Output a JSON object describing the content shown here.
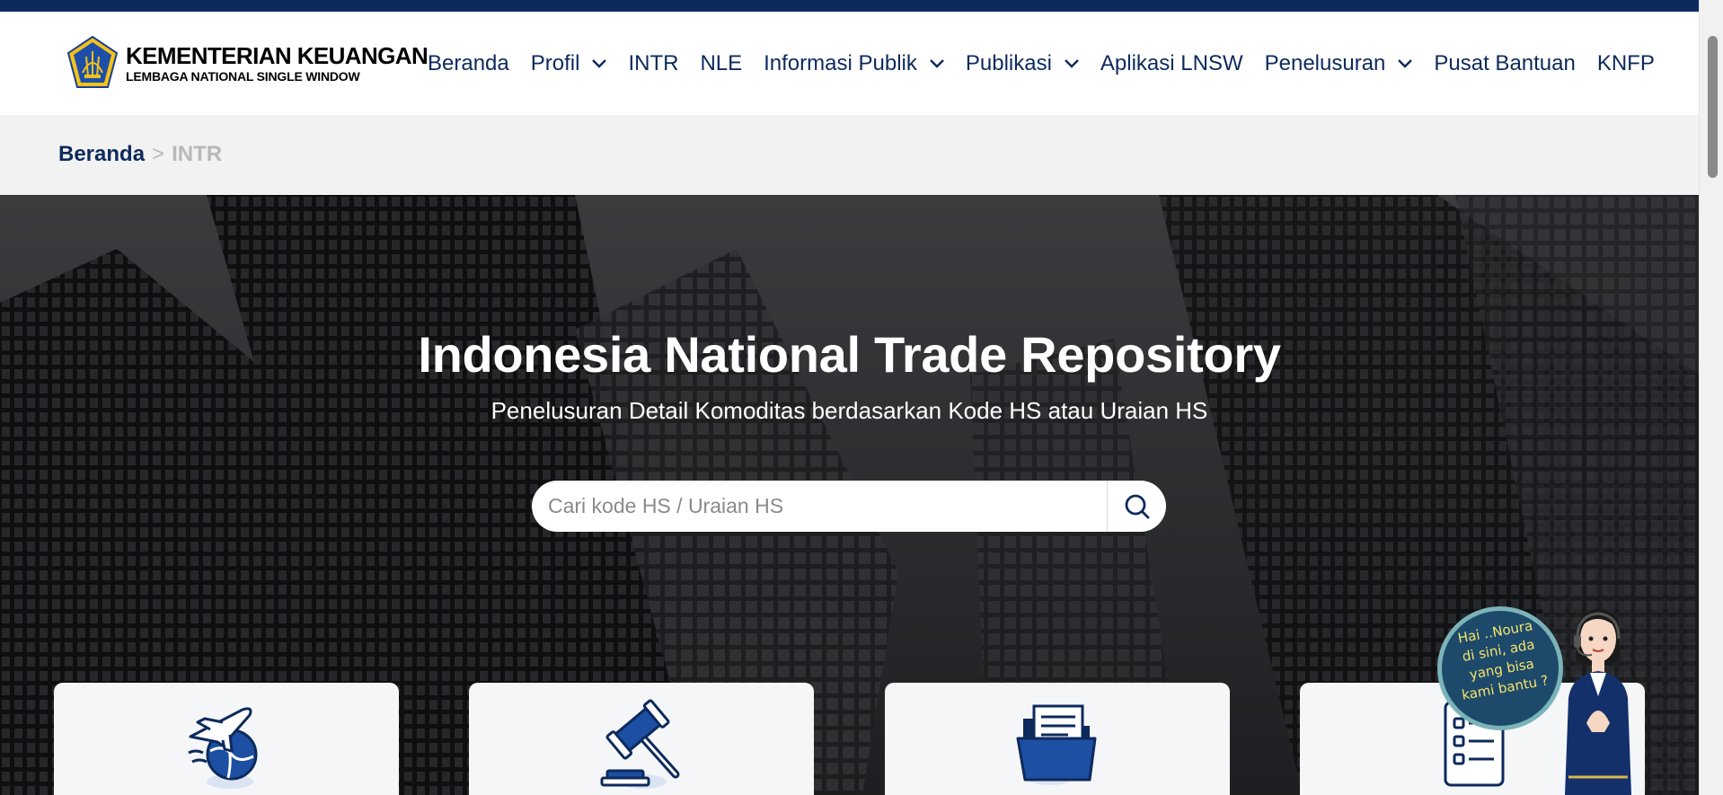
{
  "brand": {
    "title": "KEMENTERIAN KEUANGAN",
    "subtitle": "LEMBAGA NATIONAL SINGLE WINDOW",
    "logo_icon": "garuda-emblem-icon"
  },
  "nav": {
    "items": [
      {
        "label": "Beranda",
        "dropdown": false
      },
      {
        "label": "Profil",
        "dropdown": true
      },
      {
        "label": "INTR",
        "dropdown": false
      },
      {
        "label": "NLE",
        "dropdown": false
      },
      {
        "label": "Informasi Publik",
        "dropdown": true
      },
      {
        "label": "Publikasi",
        "dropdown": true
      },
      {
        "label": "Aplikasi LNSW",
        "dropdown": false
      },
      {
        "label": "Penelusuran",
        "dropdown": true
      },
      {
        "label": "Pusat Bantuan",
        "dropdown": false
      },
      {
        "label": "KNFP",
        "dropdown": false
      }
    ]
  },
  "breadcrumb": {
    "home": "Beranda",
    "separator": ">",
    "current": "INTR"
  },
  "hero": {
    "title": "Indonesia National Trade Repository",
    "subtitle": "Penelusuran Detail Komoditas berdasarkan Kode HS atau Uraian HS"
  },
  "search": {
    "placeholder": "Cari kode HS / Uraian HS",
    "value": "",
    "icon": "search-icon"
  },
  "cards": [
    {
      "icon": "airplane-globe-icon"
    },
    {
      "icon": "gavel-icon"
    },
    {
      "icon": "folder-documents-icon"
    },
    {
      "icon": "checklist-icon"
    }
  ],
  "chat": {
    "bubble_text": "Hai ..Noura\ndi sini, ada\nyang bisa\nkami bantu ?",
    "avatar_icon": "customer-service-agent-icon"
  },
  "colors": {
    "primary": "#0d2a5c",
    "crumb_bg": "#f2f2f2",
    "muted": "#b8b8b8",
    "card_bg": "#f5f6f8",
    "bubble": "#1d4a6b",
    "bubble_text": "#f7e36b"
  }
}
